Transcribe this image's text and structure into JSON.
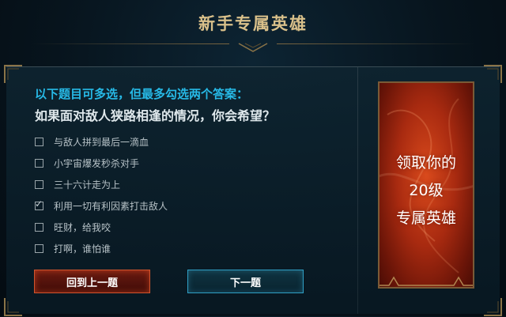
{
  "header": {
    "title": "新手专属英雄"
  },
  "question": {
    "hint": "以下题目可多选，但最多勾选两个答案：",
    "text": "如果面对敌人狭路相逢的情况，你会希望？"
  },
  "options": [
    {
      "label": "与敌人拼到最后一滴血",
      "checked": false
    },
    {
      "label": "小宇宙爆发秒杀对手",
      "checked": false
    },
    {
      "label": "三十六计走为上",
      "checked": false
    },
    {
      "label": "利用一切有利因素打击敌人",
      "checked": true
    },
    {
      "label": "旺财，给我咬",
      "checked": false
    },
    {
      "label": "打啊，谁怕谁",
      "checked": false
    }
  ],
  "check_mark": "✓",
  "buttons": {
    "prev": "回到上一题",
    "next": "下一题"
  },
  "reward": {
    "line1": "领取你的",
    "line2": "20级",
    "line3": "专属英雄"
  },
  "colors": {
    "title_gold": "#d9c08a",
    "hint_blue": "#27b9e6",
    "prev_border": "#d0542d",
    "next_border": "#2f9fc4",
    "reward_red": "#c23a16"
  }
}
